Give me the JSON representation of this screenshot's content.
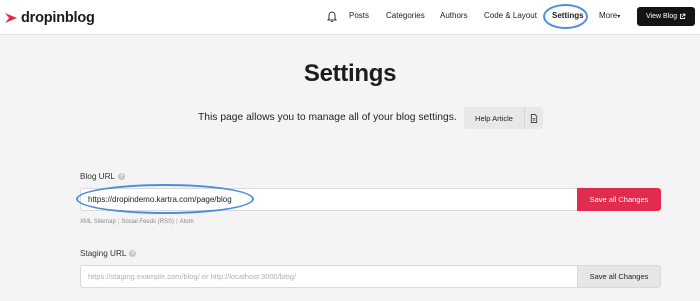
{
  "brand": {
    "name": "dropinblog",
    "accent": "#e22c4f"
  },
  "nav": {
    "items": [
      "Posts",
      "Categories",
      "Authors",
      "Code & Layout",
      "Settings",
      "More"
    ],
    "more_caret": "▾",
    "view_blog_label": "View Blog"
  },
  "page": {
    "title": "Settings",
    "subtitle": "This page allows you to manage all of your blog settings.",
    "help_label": "Help Article"
  },
  "blog_url": {
    "label": "Blog URL",
    "value": "https://dropindemo.kartra.com/page/blog",
    "save_label": "Save all Changes",
    "links": [
      "XML Sitemap",
      "Social Feeds (RSS)",
      "Atom"
    ]
  },
  "staging_url": {
    "label": "Staging URL",
    "placeholder": "https://staging.example.com/blog/ or http://localhost:3000/blog/",
    "save_label": "Save all Changes"
  },
  "colors": {
    "highlight_ring": "#4a90d9",
    "save_primary": "#e22c4f",
    "view_blog_bg": "#141414"
  },
  "icons": {
    "bell": "bell-icon",
    "external": "external-link-icon",
    "doc": "document-icon",
    "help": "question-icon"
  }
}
